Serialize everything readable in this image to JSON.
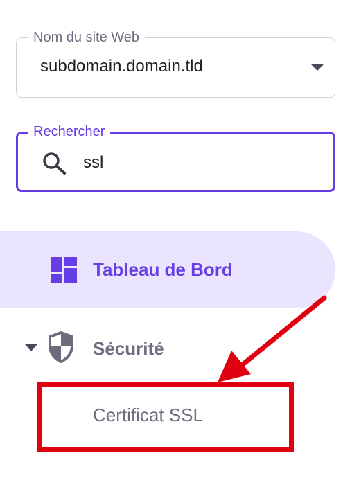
{
  "site_selector": {
    "label": "Nom du site Web",
    "value": "subdomain.domain.tld",
    "icon": "chevron-down-icon"
  },
  "search": {
    "label": "Rechercher",
    "value": "ssl",
    "icon": "search-icon"
  },
  "nav": {
    "dashboard": {
      "label": "Tableau de Bord",
      "icon": "dashboard-icon",
      "active": true
    },
    "security": {
      "label": "Sécurité",
      "icon": "shield-icon",
      "expanded": true
    },
    "ssl": {
      "label": "Certificat SSL"
    }
  },
  "colors": {
    "accent": "#673de6",
    "active_bg": "#ebe4ff",
    "muted_text": "#6b6c7e",
    "annotation_red": "#e0000f"
  }
}
